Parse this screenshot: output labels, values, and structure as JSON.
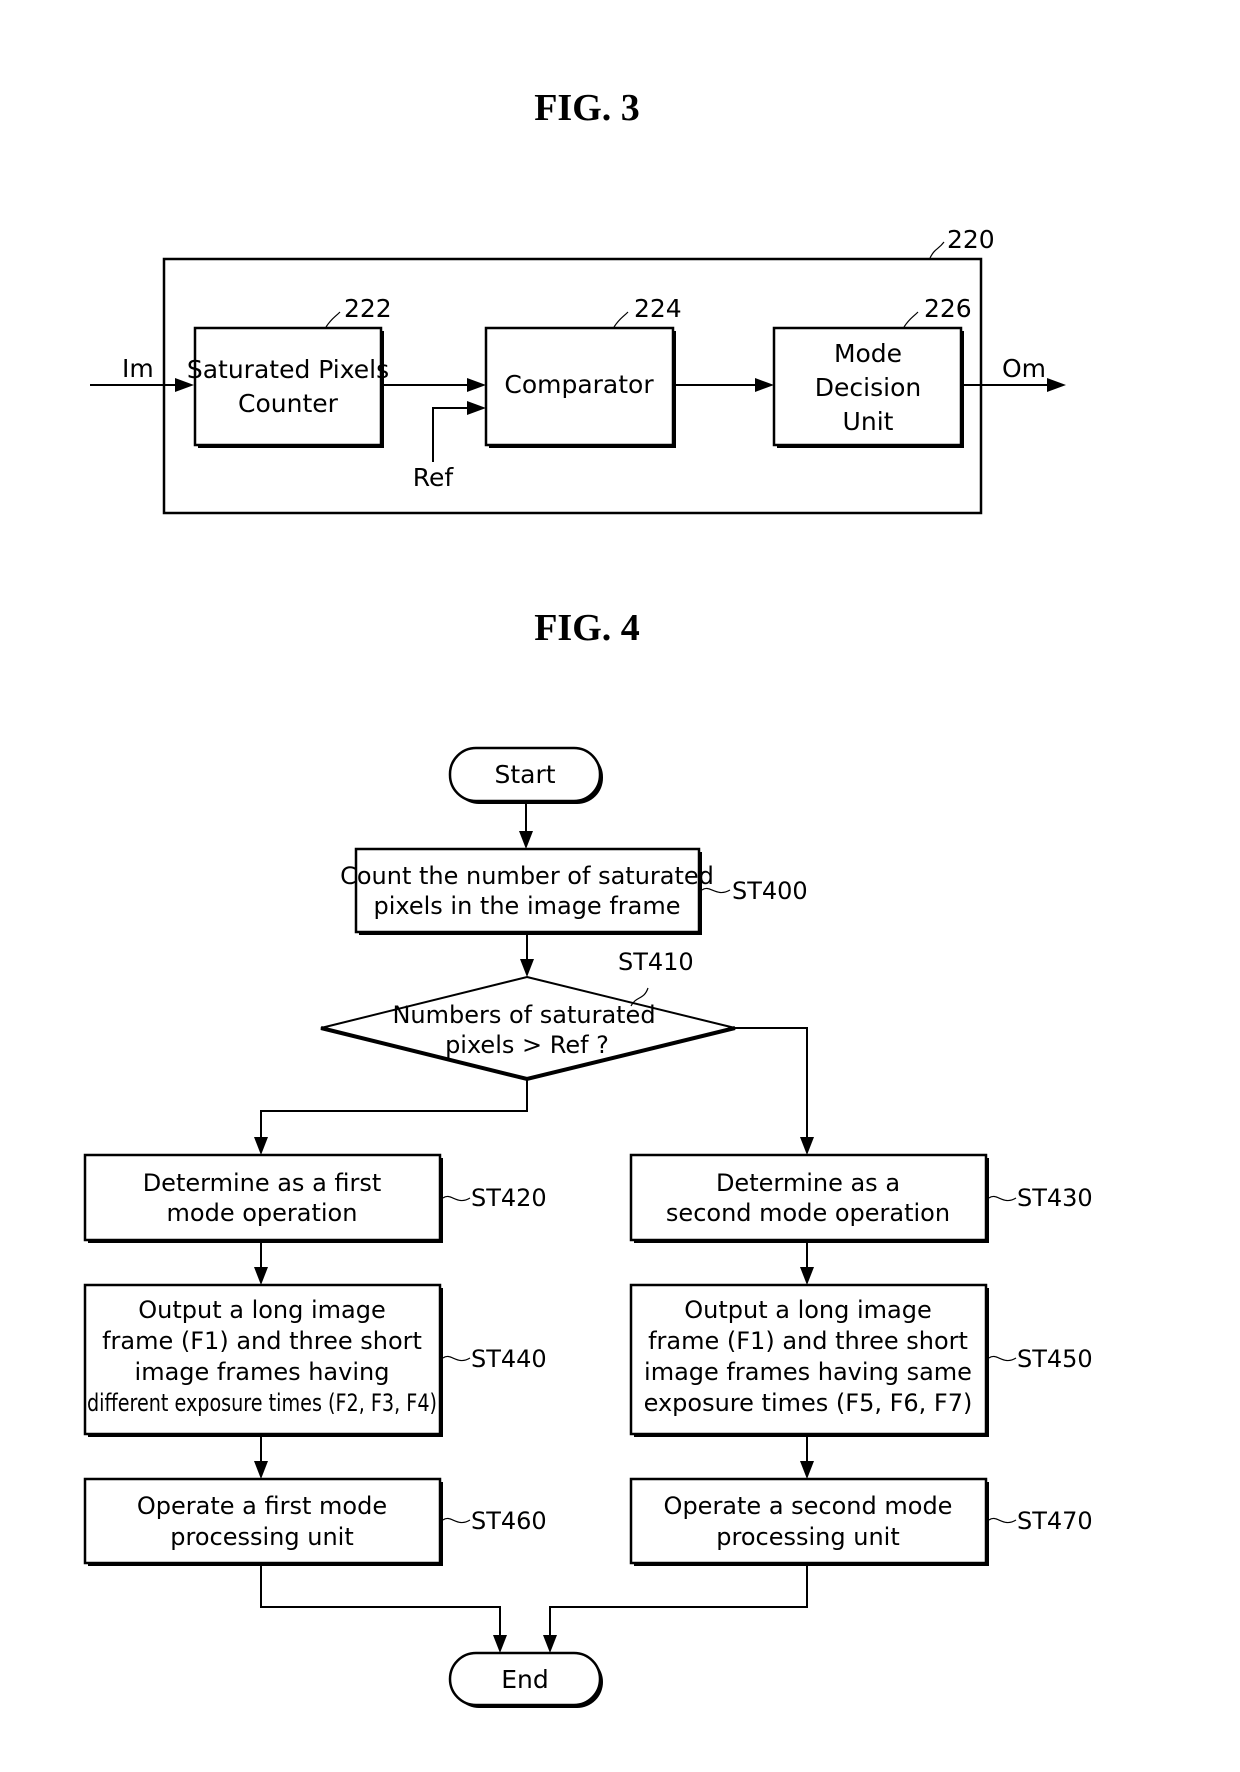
{
  "fig3": {
    "title": "FIG. 3",
    "container_ref": "220",
    "input_label": "Im",
    "output_label": "Om",
    "ref_label": "Ref",
    "blocks": [
      {
        "ref": "222",
        "lines": [
          "Saturated Pixels",
          "Counter"
        ]
      },
      {
        "ref": "224",
        "lines": [
          "Comparator"
        ]
      },
      {
        "ref": "226",
        "lines": [
          "Mode",
          "Decision",
          "Unit"
        ]
      }
    ]
  },
  "fig4": {
    "title": "FIG. 4",
    "start": "Start",
    "end": "End",
    "st400": {
      "id": "ST400",
      "lines": [
        "Count the number of saturated",
        "pixels in the image frame"
      ]
    },
    "st410": {
      "id": "ST410",
      "lines": [
        "Numbers of saturated",
        "pixels > Ref ?"
      ]
    },
    "st420": {
      "id": "ST420",
      "lines": [
        "Determine as a first",
        "mode operation"
      ]
    },
    "st430": {
      "id": "ST430",
      "lines": [
        "Determine as a",
        "second mode operation"
      ]
    },
    "st440": {
      "id": "ST440",
      "lines": [
        "Output a long image",
        "frame (F1) and three short",
        "image frames having",
        "different exposure times (F2, F3, F4)"
      ]
    },
    "st450": {
      "id": "ST450",
      "lines": [
        "Output a long image",
        "frame (F1) and three short",
        "image frames having same",
        "exposure times (F5, F6, F7)"
      ]
    },
    "st460": {
      "id": "ST460",
      "lines": [
        "Operate a first mode",
        "processing unit"
      ]
    },
    "st470": {
      "id": "ST470",
      "lines": [
        "Operate a second mode",
        "processing unit"
      ]
    }
  }
}
